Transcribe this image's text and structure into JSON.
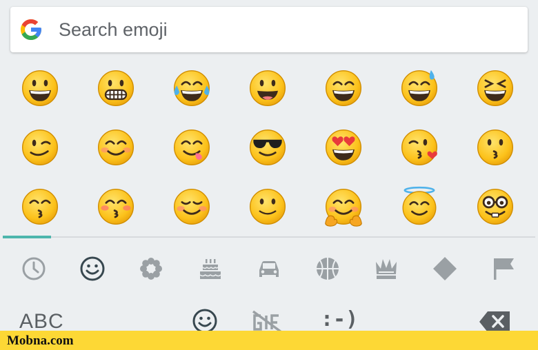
{
  "search": {
    "placeholder": "Search emoji",
    "logo_colors": [
      "#4285f4",
      "#ea4335",
      "#fbbc05",
      "#34a853"
    ]
  },
  "emoji_grid": {
    "rows": [
      [
        "grinning-face",
        "grimacing-face",
        "face-with-tears-of-joy",
        "smiling-face-open-mouth",
        "smiling-face-open-mouth-smiling-eyes",
        "smiling-face-open-mouth-cold-sweat",
        "smiling-face-tightly-closed-eyes"
      ],
      [
        "winking-face",
        "smiling-face-smiling-eyes",
        "face-savouring-food",
        "smiling-face-sunglasses",
        "smiling-face-heart-eyes",
        "face-throwing-kiss",
        "kissing-face"
      ],
      [
        "kissing-face-smiling-eyes",
        "kissing-face-closed-eyes",
        "smiling-face-blush",
        "slightly-smiling-face",
        "hugging-face",
        "smiling-face-halo",
        "nerd-face"
      ]
    ]
  },
  "categories": {
    "items": [
      "recent-icon",
      "smileys-icon",
      "nature-icon",
      "food-icon",
      "travel-icon",
      "activity-icon",
      "objects-icon",
      "symbols-icon",
      "flags-icon"
    ],
    "active_index": 1,
    "accent_color": "#4db6ac"
  },
  "bottom": {
    "abc_label": "ABC",
    "emoticon_label": ":-)",
    "items": [
      "emoji-keyboard-icon",
      "gif-off-icon",
      "delete-key-icon"
    ]
  },
  "watermark": {
    "text": "Mobna.com",
    "color": "#fdd835"
  }
}
